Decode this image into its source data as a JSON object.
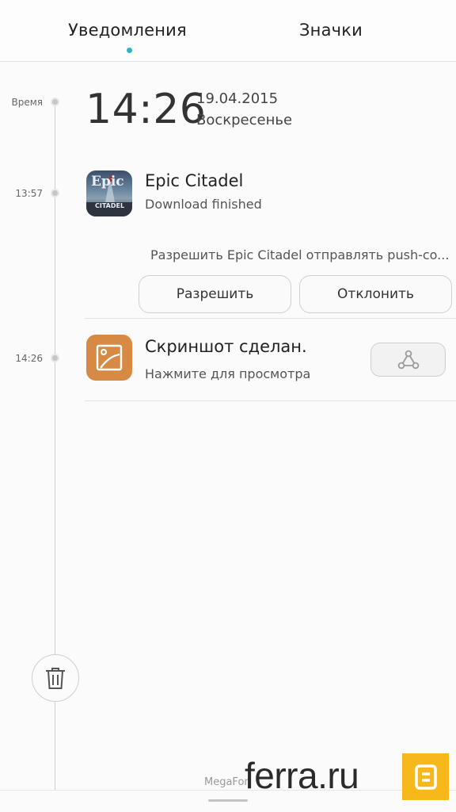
{
  "tabs": {
    "notifications": "Уведомления",
    "badges": "Значки",
    "accent_color": "#2ab7c4"
  },
  "timeline": {
    "header_label": "Время",
    "entries": [
      {
        "time": "13:57"
      },
      {
        "time": "14:26"
      }
    ]
  },
  "header": {
    "time": "14:26",
    "date": "19.04.2015",
    "weekday": "Воскресенье"
  },
  "notifications": [
    {
      "app_icon": "epic-citadel-icon",
      "icon_text": "Epic",
      "icon_subtext": "CITADEL",
      "title": "Epic Citadel",
      "subtitle": "Download finished",
      "prompt": "Разрешить Epic Citadel отправлять push-co...",
      "allow_label": "Разрешить",
      "deny_label": "Отклонить"
    },
    {
      "app_icon": "screenshot-icon",
      "icon_color": "#d68a44",
      "title": "Скриншот сделан.",
      "subtitle": "Нажмите для просмотра",
      "action_icon": "share-icon"
    }
  ],
  "footer": {
    "carrier": "MegaFon",
    "watermark": "ferra.ru",
    "watermark_color": "#f6b81a"
  },
  "icons": {
    "trash": "trash-icon"
  }
}
